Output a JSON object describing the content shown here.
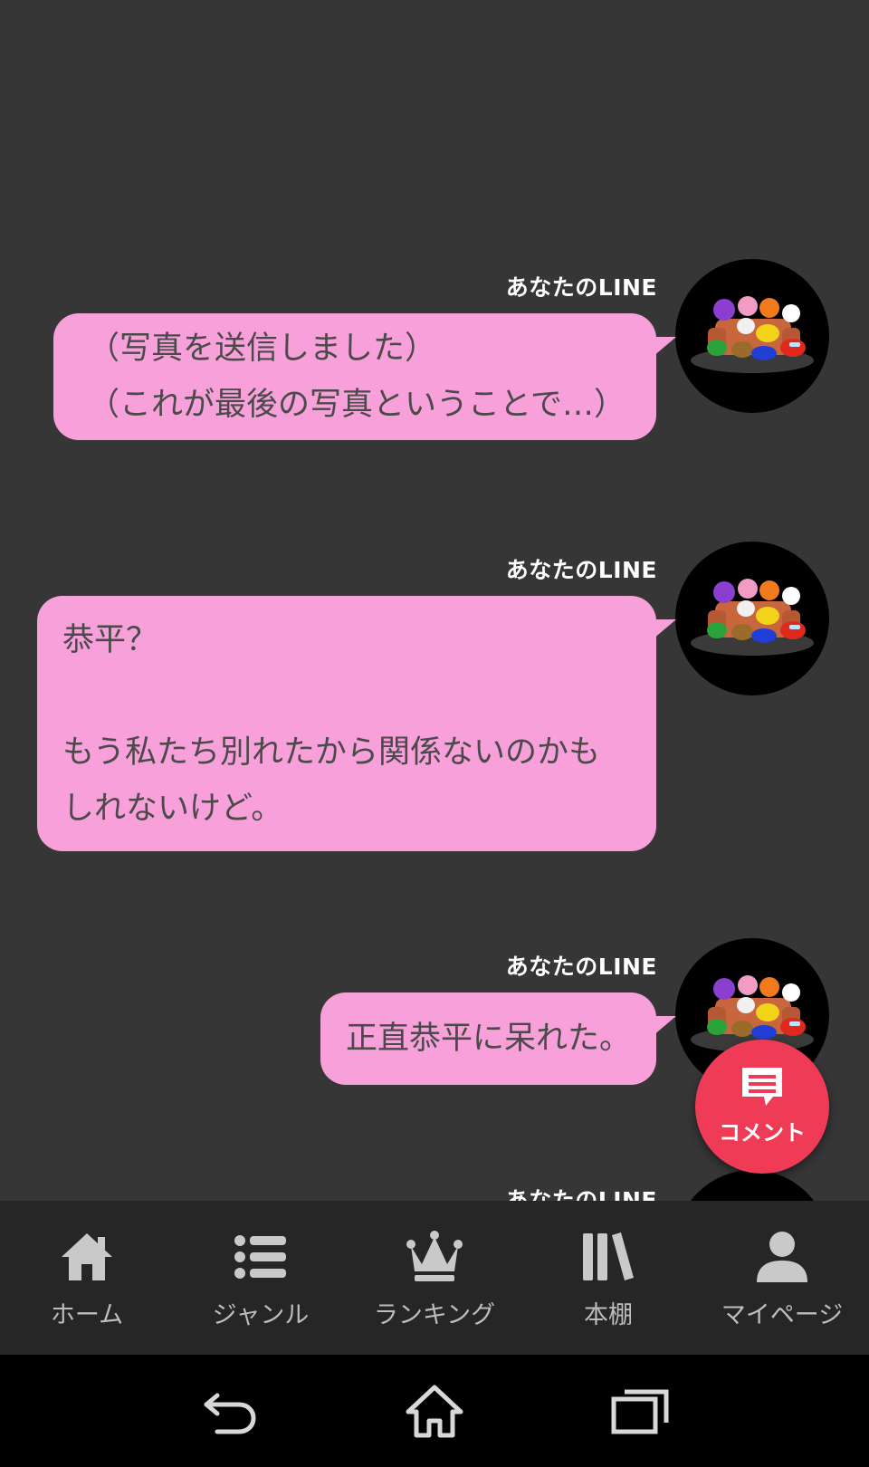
{
  "messages": [
    {
      "sender": "あなたのLINE",
      "lines": [
        "（写真を送信しました）",
        "（これが最後の写真ということで…）"
      ]
    },
    {
      "sender": "あなたのLINE",
      "lines": [
        "恭平？",
        "",
        "もう私たち別れたから関係ないのかも",
        "しれないけど。"
      ]
    },
    {
      "sender": "あなたのLINE",
      "lines": [
        "正直恭平に呆れた。"
      ]
    },
    {
      "sender": "あなたのLINE",
      "lines": []
    }
  ],
  "comment_button": {
    "label": "コメント",
    "icon": "comment-icon"
  },
  "bottom_nav": [
    {
      "label": "ホーム",
      "icon": "home-icon"
    },
    {
      "label": "ジャンル",
      "icon": "list-icon"
    },
    {
      "label": "ランキング",
      "icon": "crown-icon"
    },
    {
      "label": "本棚",
      "icon": "bookshelf-icon"
    },
    {
      "label": "マイページ",
      "icon": "person-icon"
    }
  ],
  "system_nav": [
    {
      "icon": "back-icon"
    },
    {
      "icon": "home-outline-icon"
    },
    {
      "icon": "recent-apps-icon"
    }
  ],
  "colors": {
    "background": "#363636",
    "bubble": "#f8a0da",
    "bubble_text": "#4a4a4a",
    "comment_button": "#ef3b56",
    "nav_bar": "#262626",
    "nav_text": "#bdbdbd"
  }
}
